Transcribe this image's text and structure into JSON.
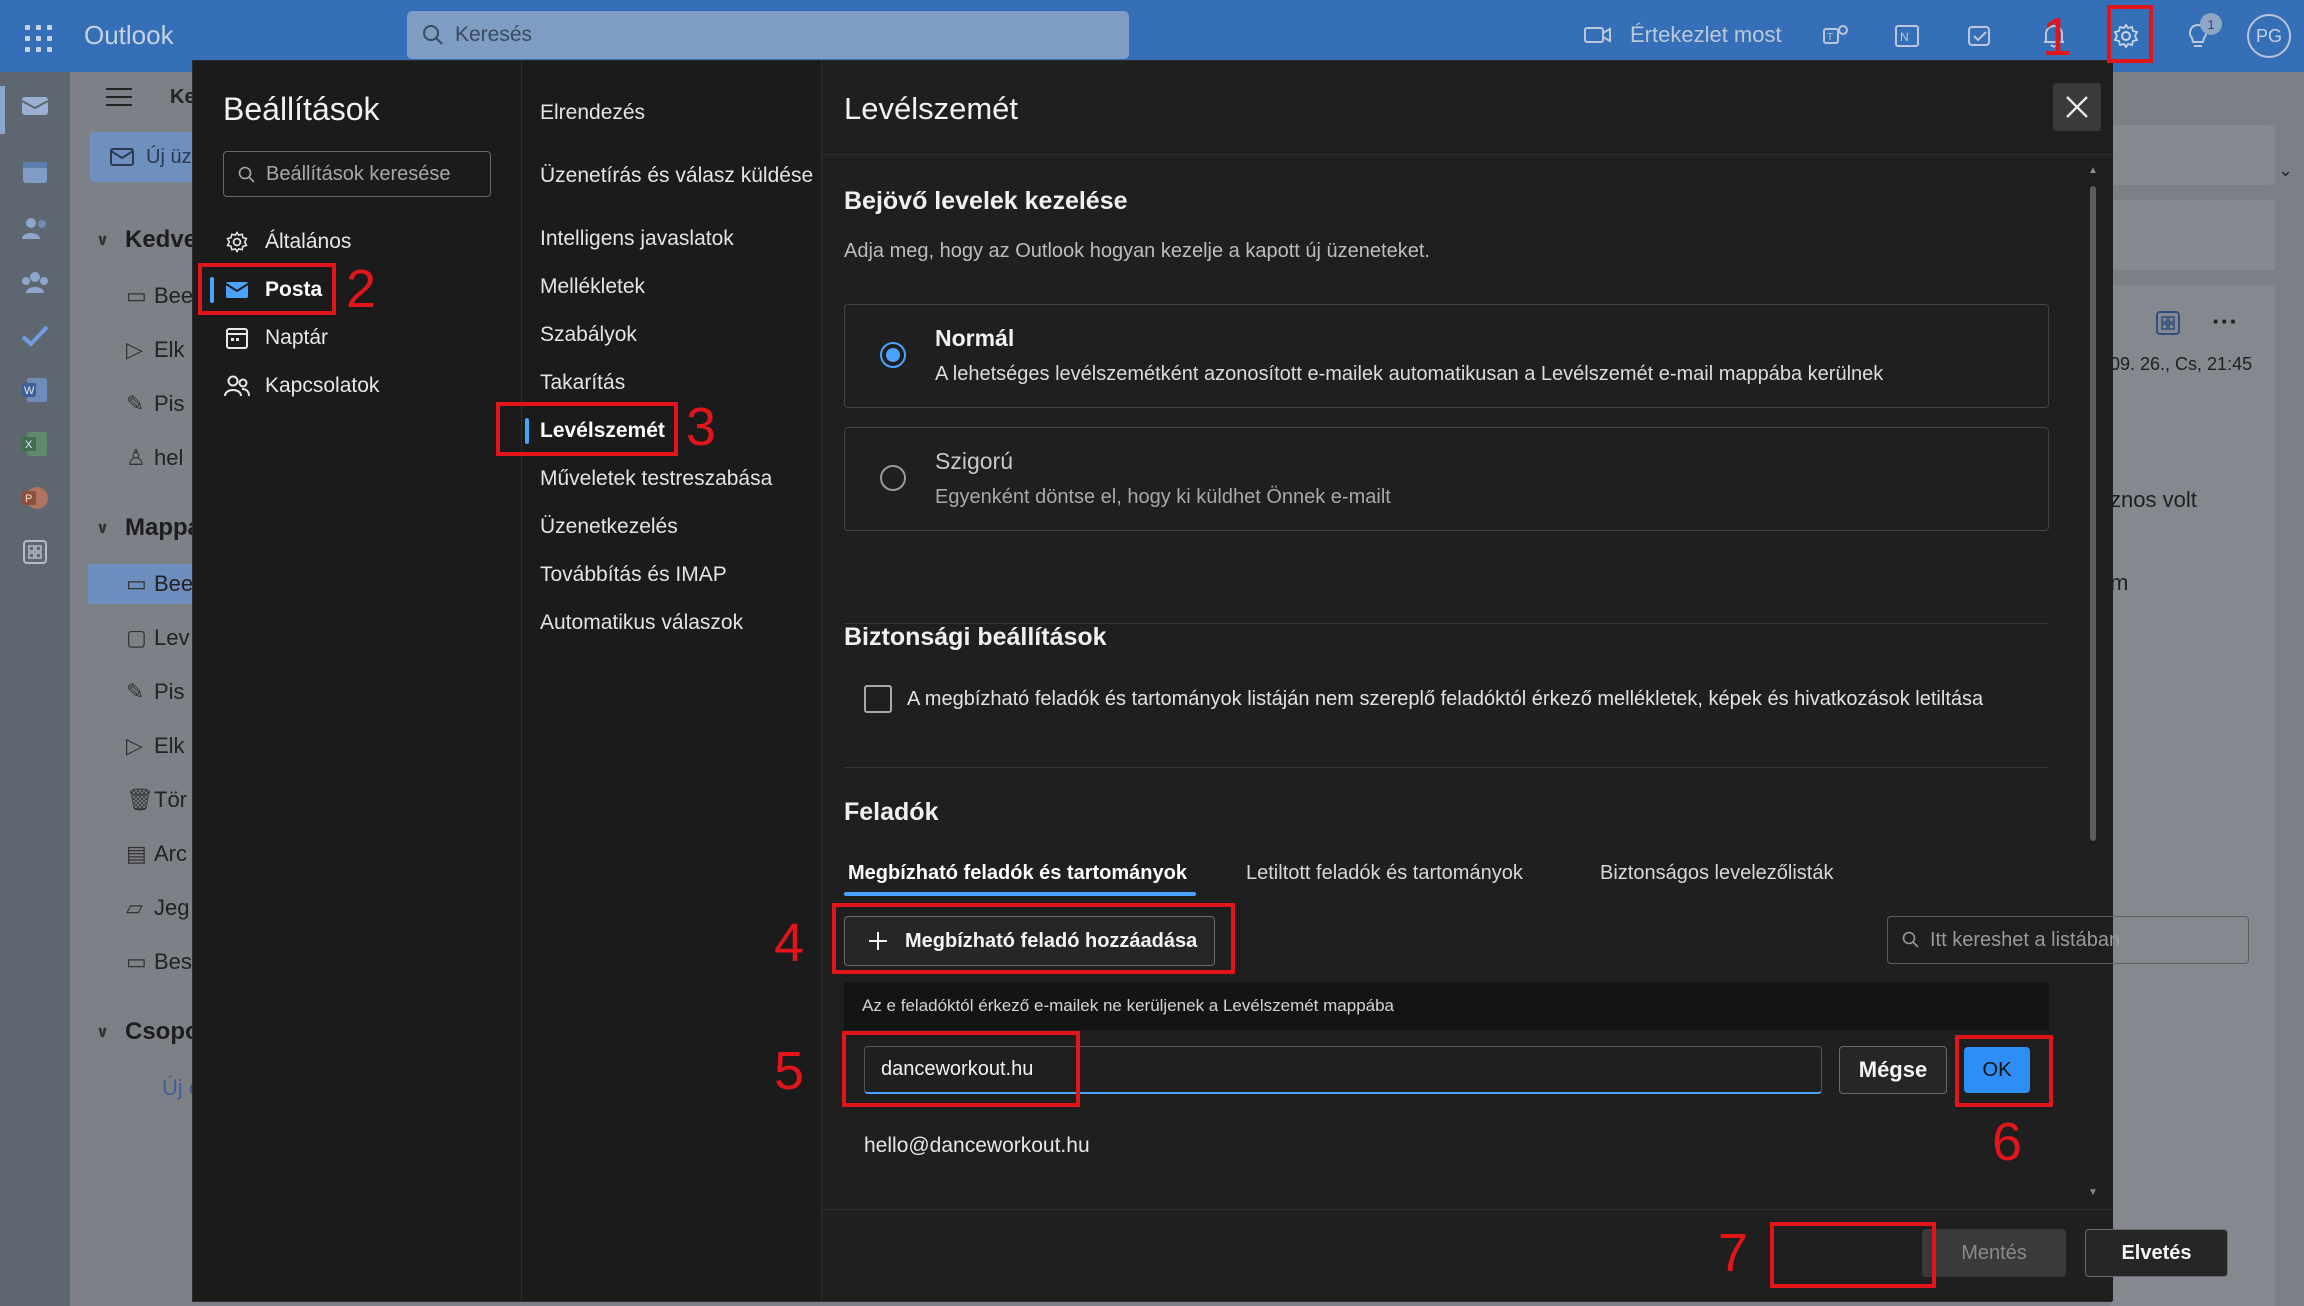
{
  "app": {
    "brand": "Outlook",
    "search_placeholder": "Keresés",
    "meet_now": "Értekezlet most",
    "avatar_initials": "PG",
    "notification_count": "1"
  },
  "background": {
    "new_mail": "Új üz",
    "tab_partial": "Ke",
    "favorites_header": "Kedve",
    "folders_header": "Mappá",
    "groups_header": "Csopo",
    "favorites": [
      "Bee",
      "Elk",
      "Pis",
      "hel"
    ],
    "folders": [
      "Bee",
      "Lev",
      "Pis",
      "Elk",
      "Tör",
      "Arc",
      "Jeg",
      "Bes"
    ],
    "groups_new": "Új c",
    "right_date": "09. 26., Cs, 21:45",
    "right_text1": "znos volt",
    "right_text2": "m"
  },
  "settings": {
    "title": "Beállítások",
    "search_placeholder": "Beállítások keresése",
    "categories": [
      {
        "label": "Általános",
        "icon": "gear-icon"
      },
      {
        "label": "Posta",
        "icon": "mail-icon",
        "active": true
      },
      {
        "label": "Naptár",
        "icon": "calendar-icon"
      },
      {
        "label": "Kapcsolatok",
        "icon": "people-icon"
      }
    ],
    "subcategories": [
      "Elrendezés",
      "Üzenetírás és válasz küldése",
      "Intelligens javaslatok",
      "Mellékletek",
      "Szabályok",
      "Takarítás",
      "Levélszemét",
      "Műveletek testreszabása",
      "Üzenetkezelés",
      "Továbbítás és IMAP",
      "Automatikus válaszok"
    ],
    "active_subcategory": "Levélszemét"
  },
  "junk": {
    "title": "Levélszemét",
    "incoming_header": "Bejövő levelek kezelése",
    "incoming_desc": "Adja meg, hogy az Outlook hogyan kezelje a kapott új üzeneteket.",
    "option_normal_title": "Normál",
    "option_normal_desc": "A lehetséges levélszemétként azonosított e-mailek automatikusan a Levélszemét e-mail mappába kerülnek",
    "option_strict_title": "Szigorú",
    "option_strict_desc": "Egyenként döntse el, hogy ki küldhet Önnek e-mailt",
    "selected_option": "Normál",
    "security_header": "Biztonsági beállítások",
    "security_checkbox": "A megbízható feladók és tartományok listáján nem szereplő feladóktól érkező mellékletek, képek és hivatkozások letiltása",
    "security_checked": false,
    "senders_header": "Feladók",
    "tabs": [
      "Megbízható feladók és tartományok",
      "Letiltott feladók és tartományok",
      "Biztonságos levelezőlisták"
    ],
    "active_tab": "Megbízható feladók és tartományok",
    "add_button": "Megbízható feladó hozzáadása",
    "list_search_placeholder": "Itt kereshet a listában",
    "info_text": "Az e feladóktól érkező e-mailek ne kerüljenek a Levélszemét mappába",
    "input_value": "danceworkout.hu",
    "cancel_button": "Mégse",
    "ok_button": "OK",
    "sender_entry": "hello@danceworkout.hu",
    "save_button": "Mentés",
    "discard_button": "Elvetés"
  },
  "annotations": [
    "1",
    "2",
    "3",
    "4",
    "5",
    "6",
    "7"
  ],
  "colors": {
    "accent": "#4aa3ff",
    "annotation": "#e2151b",
    "topbar": "#346fb8",
    "ok_button": "#2f8df6"
  }
}
